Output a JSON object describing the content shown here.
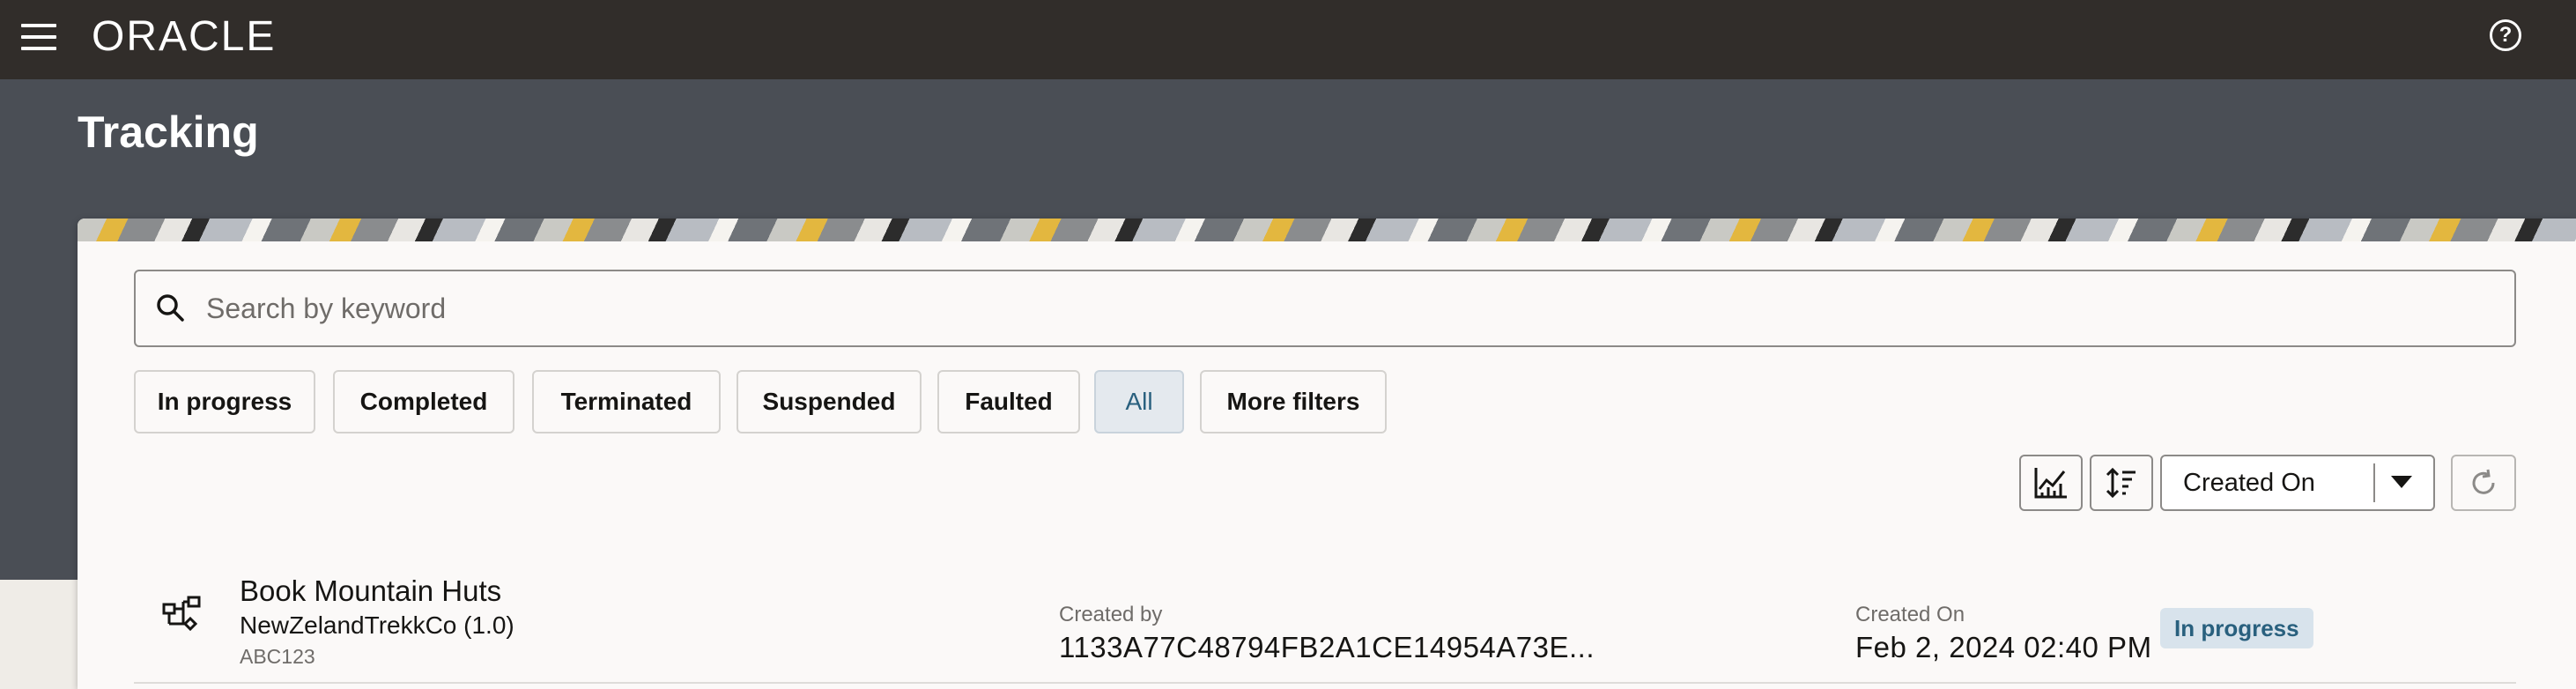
{
  "app": {
    "brand": "ORACLE",
    "menu_icon": "hamburger-menu-icon",
    "help_icon": "help-circle-icon",
    "help_glyph": "?"
  },
  "page": {
    "title": "Tracking"
  },
  "search": {
    "placeholder": "Search by keyword",
    "value": "",
    "icon": "search-icon"
  },
  "filters": [
    {
      "label": "In progress",
      "active": false
    },
    {
      "label": "Completed",
      "active": false
    },
    {
      "label": "Terminated",
      "active": false
    },
    {
      "label": "Suspended",
      "active": false
    },
    {
      "label": "Faulted",
      "active": false
    },
    {
      "label": "All",
      "active": true
    },
    {
      "label": "More filters",
      "active": false
    }
  ],
  "toolbar": {
    "chart_icon": "chart-icon",
    "sort_icon": "sort-order-icon",
    "sort_by": "Created On",
    "refresh_icon": "refresh-icon"
  },
  "results": [
    {
      "icon": "process-flow-icon",
      "title": "Book Mountain Huts",
      "application": "NewZelandTrekkCo (1.0)",
      "id": "ABC123",
      "created_by_label": "Created by",
      "created_by": "1133A77C48794FB2A1CE14954A73E...",
      "created_on_label": "Created On",
      "created_on": "Feb 2, 2024 02:40 PM",
      "status": "In progress"
    }
  ],
  "colors": {
    "topbar": "#312d2a",
    "header": "#4a4e55",
    "accent": "#29607e",
    "badge_bg": "#d8e3ec"
  }
}
